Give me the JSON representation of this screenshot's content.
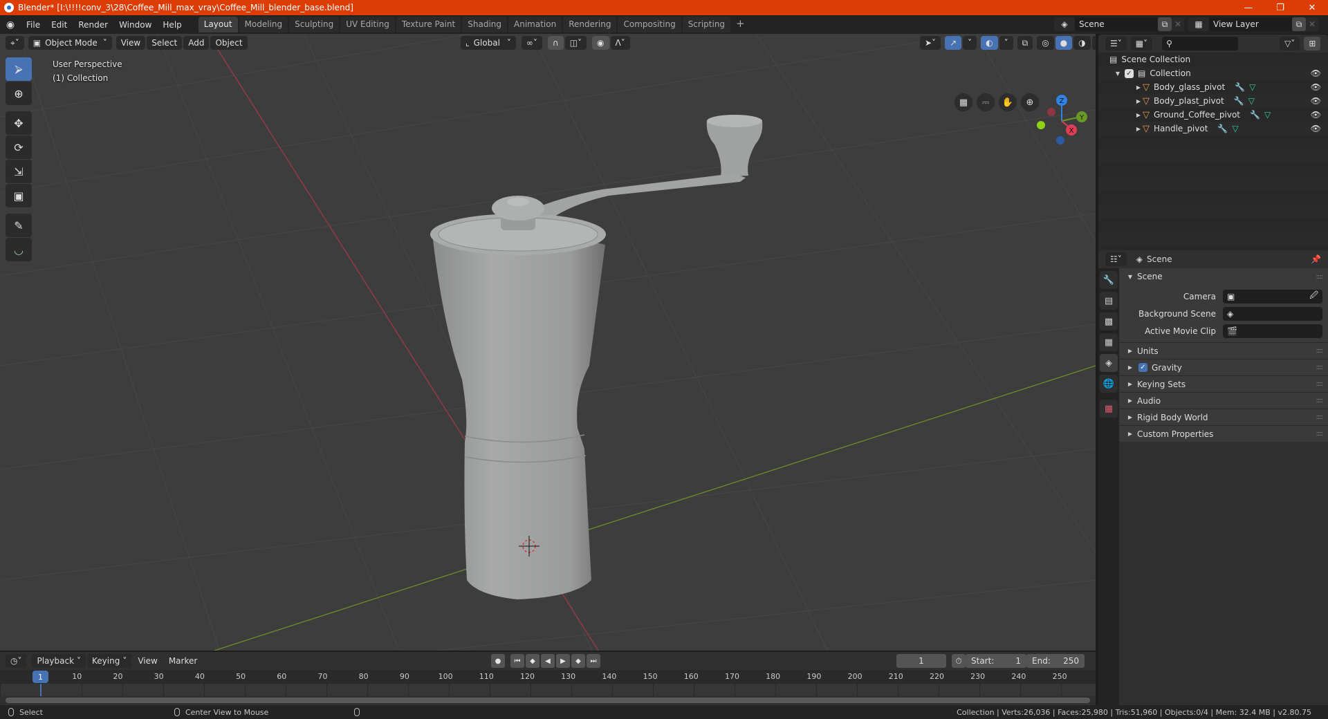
{
  "window": {
    "title": "Blender* [I:\\!!!!conv_3\\28\\Coffee_Mill_max_vray\\Coffee_Mill_blender_base.blend]",
    "controls": [
      "minimize",
      "restore",
      "close"
    ]
  },
  "menu": [
    "File",
    "Edit",
    "Render",
    "Window",
    "Help"
  ],
  "workspaces": [
    {
      "label": "Layout",
      "active": true
    },
    {
      "label": "Modeling"
    },
    {
      "label": "Sculpting"
    },
    {
      "label": "UV Editing"
    },
    {
      "label": "Texture Paint"
    },
    {
      "label": "Shading"
    },
    {
      "label": "Animation"
    },
    {
      "label": "Rendering"
    },
    {
      "label": "Compositing"
    },
    {
      "label": "Scripting"
    }
  ],
  "scene_selector": {
    "scene": "Scene",
    "view_layer": "View Layer"
  },
  "viewport": {
    "mode": "Object Mode",
    "menus": [
      "View",
      "Select",
      "Add",
      "Object"
    ],
    "orientation": "Global",
    "overlay_lines": [
      "User Perspective",
      "(1) Collection"
    ],
    "gizmo_axes": [
      "Z",
      "Y",
      "X"
    ],
    "tools": [
      "select-box",
      "cursor",
      "move",
      "rotate",
      "scale",
      "transform",
      "annotate",
      "measure"
    ]
  },
  "outliner": {
    "root": "Scene Collection",
    "collection": "Collection",
    "objects": [
      {
        "name": "Body_glass_pivot"
      },
      {
        "name": "Body_plast_pivot"
      },
      {
        "name": "Ground_Coffee_pivot"
      },
      {
        "name": "Handle_pivot"
      }
    ]
  },
  "properties": {
    "context": "Scene",
    "panel_title": "Scene",
    "fields": [
      {
        "label": "Camera",
        "value": ""
      },
      {
        "label": "Background Scene",
        "value": ""
      },
      {
        "label": "Active Movie Clip",
        "value": ""
      }
    ],
    "subpanels": [
      {
        "label": "Units"
      },
      {
        "label": "Gravity",
        "checkbox": true,
        "checked": true
      },
      {
        "label": "Keying Sets"
      },
      {
        "label": "Audio"
      },
      {
        "label": "Rigid Body World"
      },
      {
        "label": "Custom Properties"
      }
    ]
  },
  "timeline": {
    "menus": [
      "Playback",
      "Keying",
      "View",
      "Marker"
    ],
    "current_frame": "1",
    "start_label": "Start:",
    "start": "1",
    "end_label": "End:",
    "end": "250",
    "ruler": [
      "10",
      "20",
      "30",
      "40",
      "50",
      "60",
      "70",
      "80",
      "90",
      "100",
      "110",
      "120",
      "130",
      "140",
      "150",
      "160",
      "170",
      "180",
      "190",
      "200",
      "210",
      "220",
      "230",
      "240",
      "250"
    ]
  },
  "statusbar": {
    "left_action": "Select",
    "middle_action": "Center View to Mouse",
    "stats": "Collection | Verts:26,036 | Faces:25,980 | Tris:51,960 | Objects:0/4 | Mem: 32.4 MB | v2.80.75"
  }
}
